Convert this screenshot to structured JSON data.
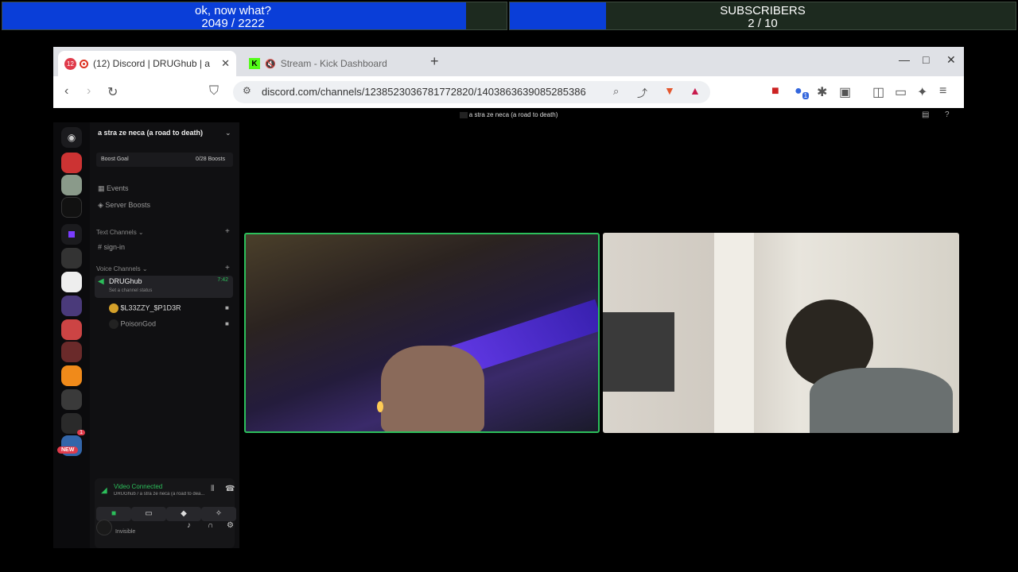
{
  "overlay": {
    "goal_left": {
      "title": "ok, now what?",
      "current": "2049",
      "separator": " / ",
      "target": "2222",
      "progress": 0.92
    },
    "goal_right": {
      "title": "SUBSCRIBERS",
      "current": "2",
      "separator": " / ",
      "target": "10",
      "progress": 0.2
    }
  },
  "browser": {
    "tabs": [
      {
        "title": "(12) Discord | DRUGhub | a",
        "badge": "12",
        "active": true
      },
      {
        "title": "Stream - Kick Dashboard",
        "active": false
      }
    ],
    "url": "discord.com/channels/1238523036781772820/1403863639085285386",
    "extension_badge": "1"
  },
  "discord": {
    "stream_title": "a stra ze neca (a road to death)",
    "server_name": "a stra ze neca (a road to death)",
    "boost_goal": "Boost Goal",
    "boost_count": "0/28 Boosts",
    "menu": [
      "Events",
      "Server Boosts"
    ],
    "text_category": "Text Channels",
    "text_channel": "sign-in",
    "voice_category": "Voice Channels",
    "voice_channel": "DRUGhub",
    "voice_time": "7:42",
    "voice_status": "Set a channel status",
    "voice_users": [
      "$L33ZZY_$P1D3R",
      "PoisonGod"
    ],
    "new_badge": "NEW",
    "guild_badge": "1",
    "connection": {
      "status": "Video Connected",
      "location": "DRUGhub / a stra ze neca (a road to dea..."
    },
    "user_status": "Invisible"
  }
}
